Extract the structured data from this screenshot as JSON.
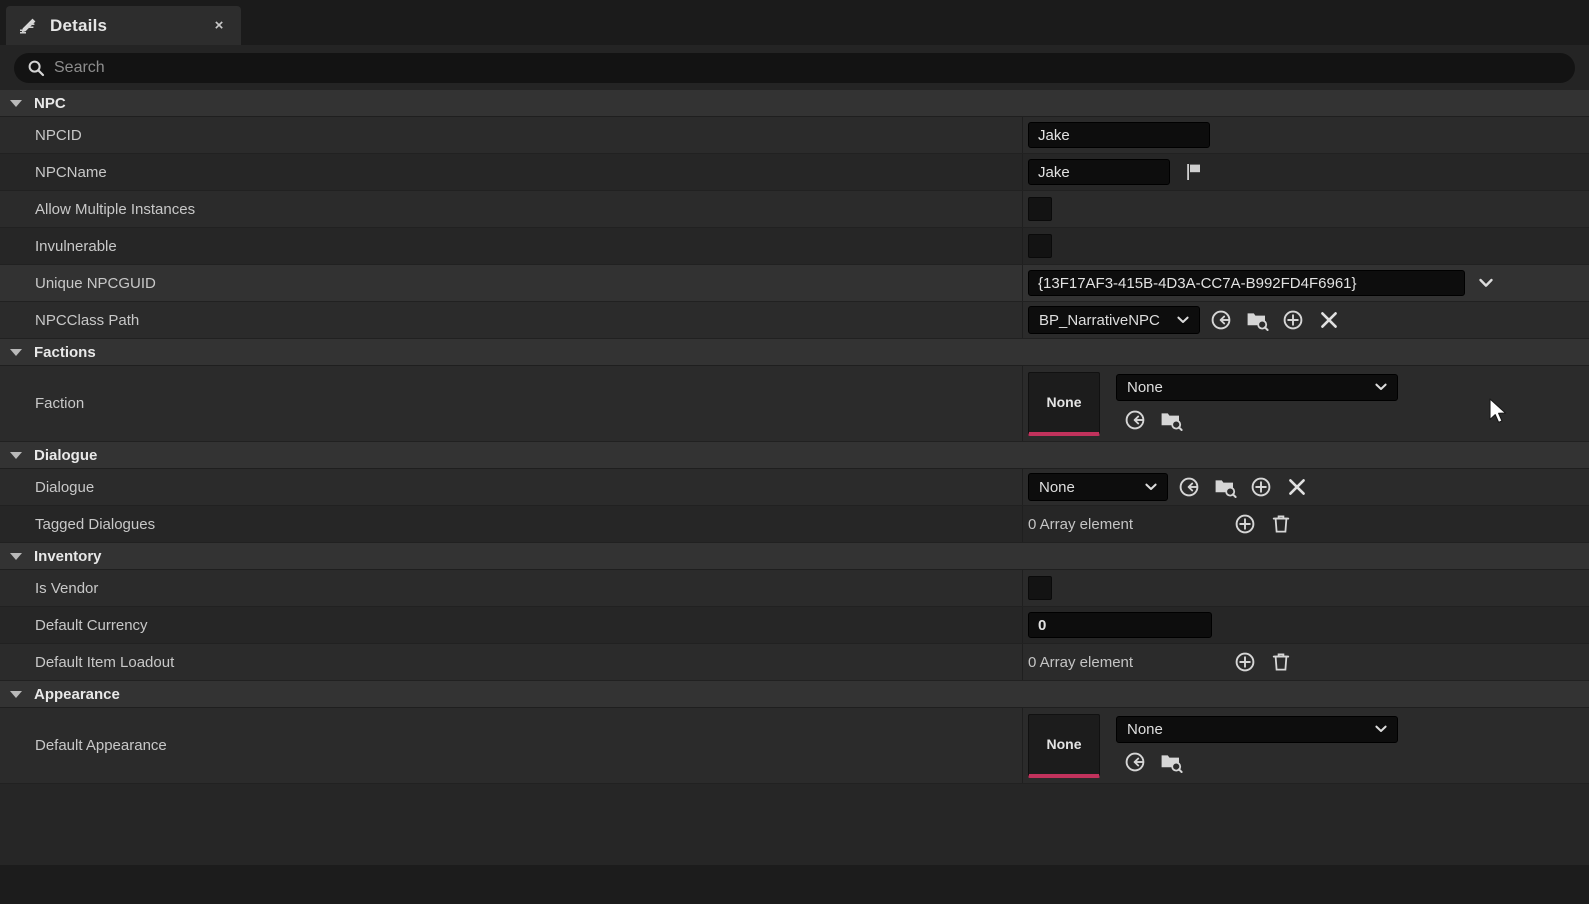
{
  "tab": {
    "title": "Details",
    "icon": "pencil-details-icon",
    "close_label": "×"
  },
  "search": {
    "placeholder": "Search",
    "value": "",
    "icon": "search-icon"
  },
  "sections": [
    {
      "id": "npc",
      "title": "NPC",
      "rows": [
        {
          "label": "NPCID",
          "widget": "text",
          "value": "Jake"
        },
        {
          "label": "NPCName",
          "widget": "text-flag",
          "value": "Jake"
        },
        {
          "label": "Allow Multiple Instances",
          "widget": "checkbox",
          "value": "unchecked"
        },
        {
          "label": "Invulnerable",
          "widget": "checkbox",
          "value": "unchecked"
        },
        {
          "label": "Unique NPCGUID",
          "widget": "guid",
          "value": "{13F17AF3-415B-4D3A-CC7A-B992FD4F6961}"
        },
        {
          "label": "NPCClass Path",
          "widget": "classpick",
          "value": "BP_NarrativeNPC"
        }
      ]
    },
    {
      "id": "factions",
      "title": "Factions",
      "rows": [
        {
          "label": "Faction",
          "widget": "assetpick",
          "value": "None",
          "thumb": "None"
        }
      ]
    },
    {
      "id": "dialogue",
      "title": "Dialogue",
      "rows": [
        {
          "label": "Dialogue",
          "widget": "objectpick",
          "value": "None"
        },
        {
          "label": "Tagged Dialogues",
          "widget": "array",
          "value": "0 Array element"
        }
      ]
    },
    {
      "id": "inventory",
      "title": "Inventory",
      "rows": [
        {
          "label": "Is Vendor",
          "widget": "checkbox",
          "value": "unchecked"
        },
        {
          "label": "Default Currency",
          "widget": "number",
          "value": "0"
        },
        {
          "label": "Default Item Loadout",
          "widget": "array",
          "value": "0 Array element"
        }
      ]
    },
    {
      "id": "appearance",
      "title": "Appearance",
      "rows": [
        {
          "label": "Default Appearance",
          "widget": "assetpick",
          "value": "None",
          "thumb": "None"
        }
      ]
    }
  ],
  "icons": {
    "flag": "flag-icon",
    "dropdown": "chevron-down-icon",
    "reset": "reset-to-default-icon",
    "browse": "browse-content-icon",
    "add": "add-element-icon",
    "clear": "clear-icon",
    "delete": "delete-icon"
  },
  "colors": {
    "accent": "#c1325c",
    "panel_bg": "#262626",
    "row_bg": "#2b2b2b",
    "row_alt_bg": "#262626",
    "header_bg": "#333333",
    "field_bg": "#0d0d0d",
    "text": "#c8c8c8"
  }
}
